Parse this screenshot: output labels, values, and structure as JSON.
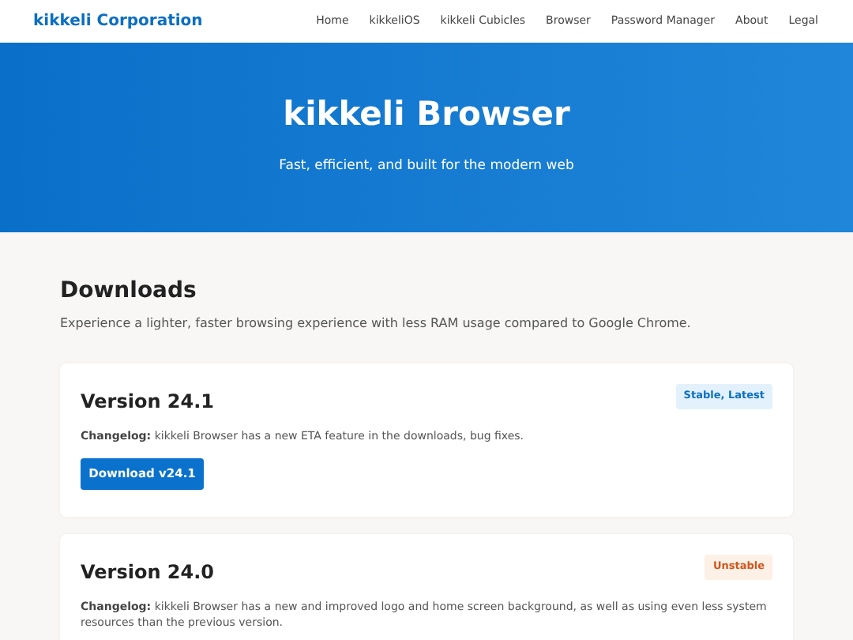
{
  "header": {
    "brand": "kikkeli Corporation",
    "nav": [
      {
        "label": "Home"
      },
      {
        "label": "kikkeliOS"
      },
      {
        "label": "kikkeli Cubicles"
      },
      {
        "label": "Browser"
      },
      {
        "label": "Password Manager"
      },
      {
        "label": "About"
      },
      {
        "label": "Legal"
      }
    ]
  },
  "hero": {
    "title": "kikkeli Browser",
    "subtitle": "Fast, efficient, and built for the modern web"
  },
  "downloads": {
    "heading": "Downloads",
    "description": "Experience a lighter, faster browsing experience with less RAM usage compared to Google Chrome.",
    "versions": [
      {
        "title": "Version 24.1",
        "badge": {
          "label": "Stable, Latest",
          "kind": "stable"
        },
        "changelog": "**Changelog:** kikkeli Browser has a new ETA feature in the downloads, bug fixes.",
        "button": "Download v24.1"
      },
      {
        "title": "Version 24.0",
        "badge": {
          "label": "Unstable",
          "kind": "unstable"
        },
        "changelog": "**Changelog:** kikkeli Browser has a new and improved logo and home screen background, as well as using even less system resources than the previous version."
      }
    ]
  }
}
